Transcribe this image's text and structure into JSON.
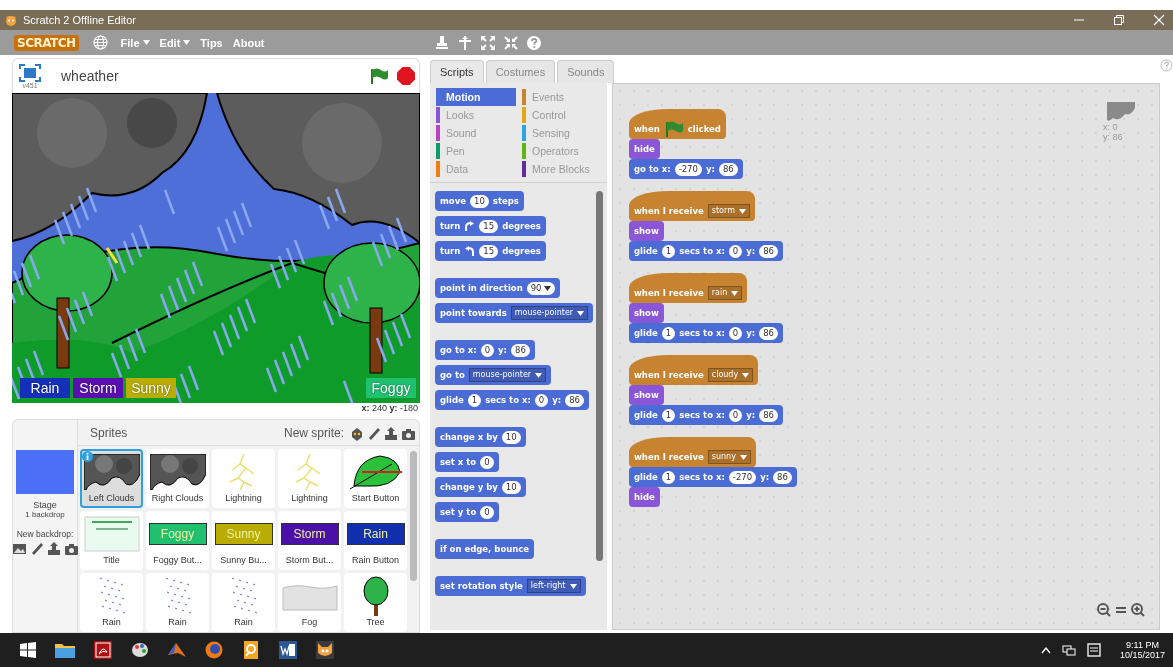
{
  "window": {
    "title": "Scratch 2 Offline Editor"
  },
  "menu": {
    "logo": "SCRATCH",
    "items": [
      {
        "label": "File",
        "dropdown": true
      },
      {
        "label": "Edit",
        "dropdown": true
      },
      {
        "label": "Tips",
        "dropdown": false
      },
      {
        "label": "About",
        "dropdown": false
      }
    ]
  },
  "stage": {
    "project_title": "wheather",
    "version": "v451",
    "coordinates": "**x:** 240  **y:** -180",
    "left_buttons": [
      {
        "label": "Rain",
        "color": "#1530b8"
      },
      {
        "label": "Storm",
        "color": "#5a0fb0"
      },
      {
        "label": "Sunny",
        "color": "#b8ad00"
      }
    ],
    "right_buttons": [
      {
        "label": "Foggy",
        "color": "#1fc070"
      }
    ]
  },
  "sprites": {
    "header": "Sprites",
    "new_sprite_label": "New sprite:",
    "stage_label": "Stage",
    "backdrop_count": "1 backdrop",
    "new_backdrop_label": "New backdrop:",
    "items": [
      {
        "name": "Left Clouds",
        "kind": "clouds",
        "selected": true
      },
      {
        "name": "Right Clouds",
        "kind": "clouds",
        "selected": false
      },
      {
        "name": "Lightning",
        "kind": "lightning",
        "selected": false
      },
      {
        "name": "Lightning",
        "kind": "lightning",
        "selected": false
      },
      {
        "name": "Start Button",
        "kind": "leaf",
        "selected": false
      },
      {
        "name": "Title",
        "kind": "title",
        "selected": false
      },
      {
        "name": "Foggy But...",
        "kind": "button",
        "thumb_text": "Foggy",
        "color": "#20c070",
        "selected": false
      },
      {
        "name": "Sunny Bu...",
        "kind": "button",
        "thumb_text": "Sunny",
        "color": "#b8ad00",
        "selected": false
      },
      {
        "name": "Storm But...",
        "kind": "button",
        "thumb_text": "Storm",
        "color": "#4a10a8",
        "selected": false
      },
      {
        "name": "Rain Button",
        "kind": "button",
        "thumb_text": "Rain",
        "color": "#1030b0",
        "selected": false
      },
      {
        "name": "Rain",
        "kind": "rain",
        "selected": false
      },
      {
        "name": "Rain",
        "kind": "rain",
        "selected": false
      },
      {
        "name": "Rain",
        "kind": "rain",
        "selected": false
      },
      {
        "name": "Fog",
        "kind": "fog",
        "selected": false
      },
      {
        "name": "Tree",
        "kind": "tree",
        "selected": false
      }
    ]
  },
  "tabs": [
    {
      "label": "Scripts",
      "selected": true
    },
    {
      "label": "Costumes",
      "selected": false
    },
    {
      "label": "Sounds",
      "selected": false
    }
  ],
  "palette": {
    "categories": [
      {
        "label": "Motion",
        "color": "#4a6cd4",
        "selected": true
      },
      {
        "label": "Events",
        "color": "#c88330",
        "selected": false
      },
      {
        "label": "Looks",
        "color": "#8a55d7",
        "selected": false
      },
      {
        "label": "Control",
        "color": "#e1a91a",
        "selected": false
      },
      {
        "label": "Sound",
        "color": "#bb42c3",
        "selected": false
      },
      {
        "label": "Sensing",
        "color": "#2ca5e2",
        "selected": false
      },
      {
        "label": "Pen",
        "color": "#0e9a6c",
        "selected": false
      },
      {
        "label": "Operators",
        "color": "#5cb712",
        "selected": false
      },
      {
        "label": "Data",
        "color": "#ee7d16",
        "selected": false
      },
      {
        "label": "More Blocks",
        "color": "#632d99",
        "selected": false
      }
    ],
    "groups": [
      [
        [
          {
            "kind": "text",
            "text": "move"
          },
          {
            "kind": "number",
            "text": "10"
          },
          {
            "kind": "text",
            "text": "steps"
          }
        ],
        [
          {
            "kind": "text",
            "text": "turn"
          },
          {
            "kind": "rotate-cw"
          },
          {
            "kind": "number",
            "text": "15"
          },
          {
            "kind": "text",
            "text": "degrees"
          }
        ],
        [
          {
            "kind": "text",
            "text": "turn"
          },
          {
            "kind": "rotate-ccw"
          },
          {
            "kind": "number",
            "text": "15"
          },
          {
            "kind": "text",
            "text": "degrees"
          }
        ]
      ],
      [
        [
          {
            "kind": "text",
            "text": "point in direction"
          },
          {
            "kind": "number-menu",
            "text": "90"
          }
        ],
        [
          {
            "kind": "text",
            "text": "point towards"
          },
          {
            "kind": "dropdown",
            "text": "mouse-pointer"
          }
        ]
      ],
      [
        [
          {
            "kind": "text",
            "text": "go to x:"
          },
          {
            "kind": "number",
            "text": "0"
          },
          {
            "kind": "text",
            "text": "y:"
          },
          {
            "kind": "number",
            "text": "86"
          }
        ],
        [
          {
            "kind": "text",
            "text": "go to"
          },
          {
            "kind": "dropdown",
            "text": "mouse-pointer"
          }
        ],
        [
          {
            "kind": "text",
            "text": "glide"
          },
          {
            "kind": "number",
            "text": "1"
          },
          {
            "kind": "text",
            "text": "secs to x:"
          },
          {
            "kind": "number",
            "text": "0"
          },
          {
            "kind": "text",
            "text": "y:"
          },
          {
            "kind": "number",
            "text": "86"
          }
        ]
      ],
      [
        [
          {
            "kind": "text",
            "text": "change x by"
          },
          {
            "kind": "number",
            "text": "10"
          }
        ],
        [
          {
            "kind": "text",
            "text": "set x to"
          },
          {
            "kind": "number",
            "text": "0"
          }
        ],
        [
          {
            "kind": "text",
            "text": "change y by"
          },
          {
            "kind": "number",
            "text": "10"
          }
        ],
        [
          {
            "kind": "text",
            "text": "set y to"
          },
          {
            "kind": "number",
            "text": "0"
          }
        ]
      ],
      [
        [
          {
            "kind": "text",
            "text": "if on edge, bounce"
          }
        ]
      ],
      [
        [
          {
            "kind": "text",
            "text": "set rotation style"
          },
          {
            "kind": "dropdown",
            "text": "left-right"
          }
        ]
      ]
    ]
  },
  "scripts": {
    "sprite_x": "x: 0",
    "sprite_y": "y: 86",
    "list": [
      [
        {
          "kind": "hat",
          "color": "#c88330",
          "parts": [
            {
              "kind": "text",
              "text": "when"
            },
            {
              "kind": "flag"
            },
            {
              "kind": "text",
              "text": "clicked"
            }
          ]
        },
        {
          "kind": "stack",
          "color": "#8a55d7",
          "parts": [
            {
              "kind": "text",
              "text": "hide"
            }
          ]
        },
        {
          "kind": "stack",
          "color": "#4a6cd4",
          "parts": [
            {
              "kind": "text",
              "text": "go to x:"
            },
            {
              "kind": "number",
              "text": "-270"
            },
            {
              "kind": "text",
              "text": "y:"
            },
            {
              "kind": "number",
              "text": "86"
            }
          ]
        }
      ],
      [
        {
          "kind": "hat",
          "color": "#c88330",
          "parts": [
            {
              "kind": "text",
              "text": "when I receive"
            },
            {
              "kind": "dropdown",
              "text": "storm"
            }
          ]
        },
        {
          "kind": "stack",
          "color": "#8a55d7",
          "parts": [
            {
              "kind": "text",
              "text": "show"
            }
          ]
        },
        {
          "kind": "stack",
          "color": "#4a6cd4",
          "parts": [
            {
              "kind": "text",
              "text": "glide"
            },
            {
              "kind": "number",
              "text": "1"
            },
            {
              "kind": "text",
              "text": "secs to x:"
            },
            {
              "kind": "number",
              "text": "0"
            },
            {
              "kind": "text",
              "text": "y:"
            },
            {
              "kind": "number",
              "text": "86"
            }
          ]
        }
      ],
      [
        {
          "kind": "hat",
          "color": "#c88330",
          "parts": [
            {
              "kind": "text",
              "text": "when I receive"
            },
            {
              "kind": "dropdown",
              "text": "rain"
            }
          ]
        },
        {
          "kind": "stack",
          "color": "#8a55d7",
          "parts": [
            {
              "kind": "text",
              "text": "show"
            }
          ]
        },
        {
          "kind": "stack",
          "color": "#4a6cd4",
          "parts": [
            {
              "kind": "text",
              "text": "glide"
            },
            {
              "kind": "number",
              "text": "1"
            },
            {
              "kind": "text",
              "text": "secs to x:"
            },
            {
              "kind": "number",
              "text": "0"
            },
            {
              "kind": "text",
              "text": "y:"
            },
            {
              "kind": "number",
              "text": "86"
            }
          ]
        }
      ],
      [
        {
          "kind": "hat",
          "color": "#c88330",
          "parts": [
            {
              "kind": "text",
              "text": "when I receive"
            },
            {
              "kind": "dropdown",
              "text": "cloudy"
            }
          ]
        },
        {
          "kind": "stack",
          "color": "#8a55d7",
          "parts": [
            {
              "kind": "text",
              "text": "show"
            }
          ]
        },
        {
          "kind": "stack",
          "color": "#4a6cd4",
          "parts": [
            {
              "kind": "text",
              "text": "glide"
            },
            {
              "kind": "number",
              "text": "1"
            },
            {
              "kind": "text",
              "text": "secs to x:"
            },
            {
              "kind": "number",
              "text": "0"
            },
            {
              "kind": "text",
              "text": "y:"
            },
            {
              "kind": "number",
              "text": "86"
            }
          ]
        }
      ],
      [
        {
          "kind": "hat",
          "color": "#c88330",
          "parts": [
            {
              "kind": "text",
              "text": "when I receive"
            },
            {
              "kind": "dropdown",
              "text": "sunny"
            }
          ]
        },
        {
          "kind": "stack",
          "color": "#4a6cd4",
          "parts": [
            {
              "kind": "text",
              "text": "glide"
            },
            {
              "kind": "number",
              "text": "1"
            },
            {
              "kind": "text",
              "text": "secs to x:"
            },
            {
              "kind": "number",
              "text": "-270"
            },
            {
              "kind": "text",
              "text": "y:"
            },
            {
              "kind": "number",
              "text": "86"
            }
          ]
        },
        {
          "kind": "stack",
          "color": "#8a55d7",
          "parts": [
            {
              "kind": "text",
              "text": "hide"
            }
          ]
        }
      ]
    ]
  },
  "taskbar": {
    "time": "9:11 PM",
    "date": "10/15/2017"
  }
}
